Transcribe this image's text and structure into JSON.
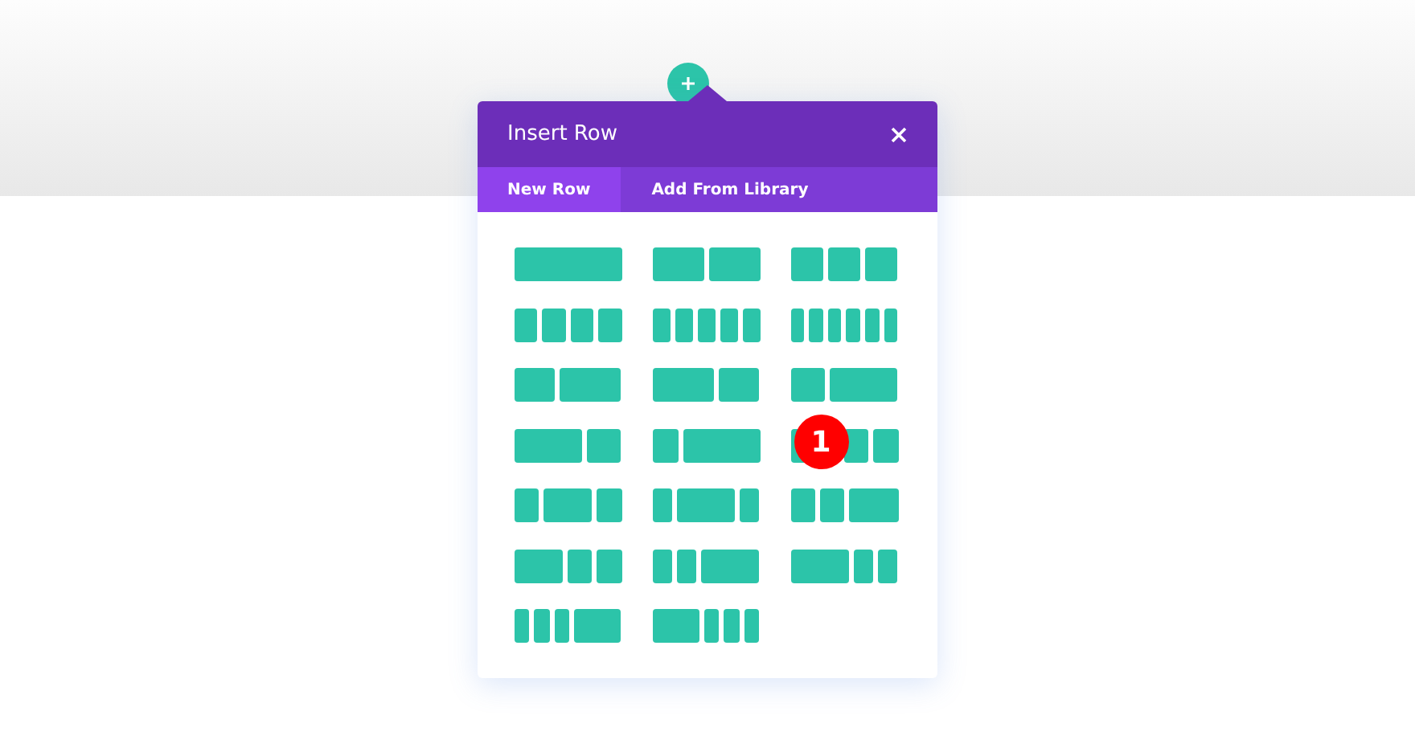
{
  "modal": {
    "title": "Insert Row",
    "tabs": [
      {
        "label": "New Row",
        "selected": true
      },
      {
        "label": "Add From Library",
        "selected": false
      }
    ],
    "layouts": [
      {
        "kind": "full"
      },
      {
        "kind": "halves"
      },
      {
        "kind": "thirds"
      },
      {
        "kind": "quarters"
      },
      {
        "kind": "fifths"
      },
      {
        "kind": "sixths"
      },
      {
        "kind": "twofifths_threefifths"
      },
      {
        "kind": "threefifths_twofifths"
      },
      {
        "kind": "third_twothirds"
      },
      {
        "kind": "twothirds_third"
      },
      {
        "kind": "quarter_threequarters"
      },
      {
        "kind": "half_quarter_quarter"
      },
      {
        "kind": "quarter_half_quarter"
      },
      {
        "kind": "fifth_threefifths_fifth"
      },
      {
        "kind": "quarter_quarter_half"
      },
      {
        "kind": "half_quarter_quarter"
      },
      {
        "kind": "fifth_fifth_threefifths"
      },
      {
        "kind": "threefifths_fifth_fifth"
      },
      {
        "kind": "sixth_sixth_sixth_half"
      },
      {
        "kind": "half_sixth_sixth_sixth"
      }
    ],
    "badge": "1"
  }
}
